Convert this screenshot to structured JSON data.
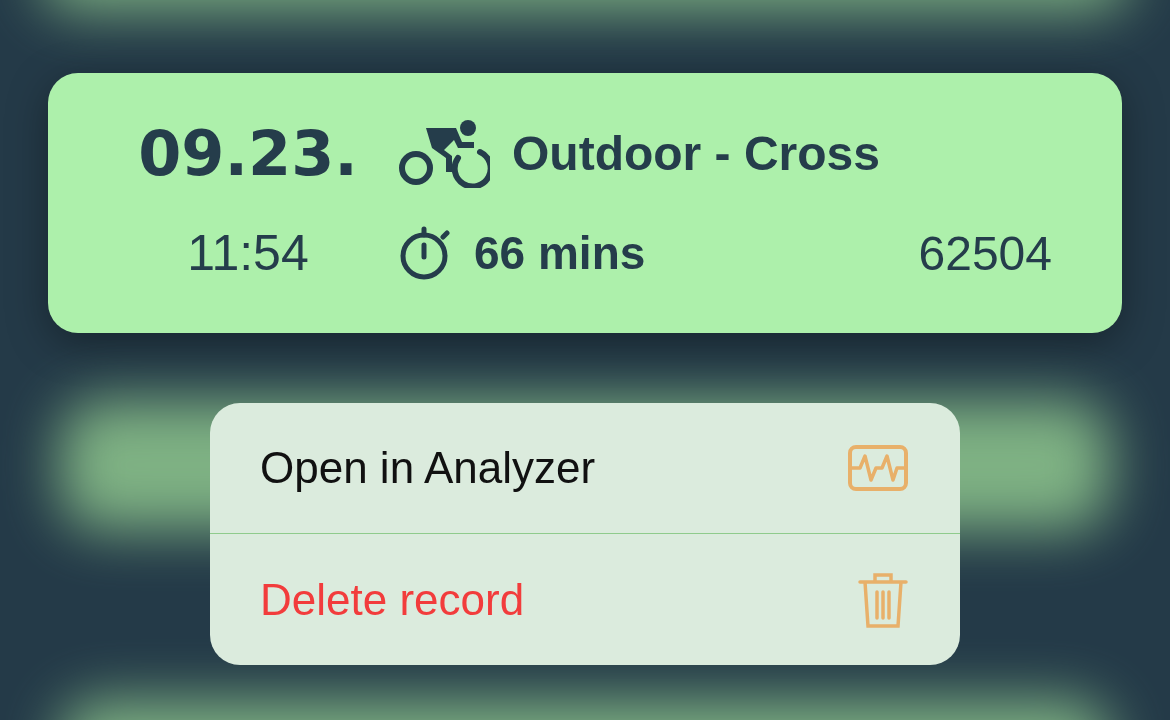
{
  "record": {
    "date": "09.23.",
    "time": "11:54",
    "activity": "Outdoor - Cross",
    "duration": "66 mins",
    "value": "62504"
  },
  "menu": [
    {
      "label": "Open in Analyzer",
      "kind": "action"
    },
    {
      "label": "Delete record",
      "kind": "destructive"
    }
  ]
}
